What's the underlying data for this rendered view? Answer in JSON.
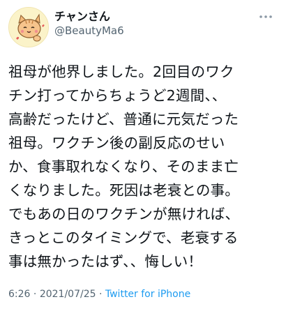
{
  "user": {
    "display_name": "チャンさん",
    "handle": "@BeautyMa6",
    "avatar_icon": "cat-avatar-icon"
  },
  "more_icon": "more-dots-icon",
  "tweet": {
    "text": "祖母が他界しました。2回目のワク\nチン打ってからちょうど2週間、、\n高齢だったけど、普通に元気だった\n祖母。ワクチン後の副反応のせい\nか、食事取れなくなり、そのまま亡\nくなりました。死因は老衰との事。\nでもあの日のワクチンが無ければ、\nきっとこのタイミングで、老衰する\n事は無かったはず、、悔しい！",
    "time": "6:26",
    "separator1": "·",
    "date": "2021/07/25",
    "separator2": "·",
    "source": "Twitter for iPhone"
  },
  "colors": {
    "text": "#0f1419",
    "secondary": "#536471",
    "link": "#1d9bf0"
  }
}
